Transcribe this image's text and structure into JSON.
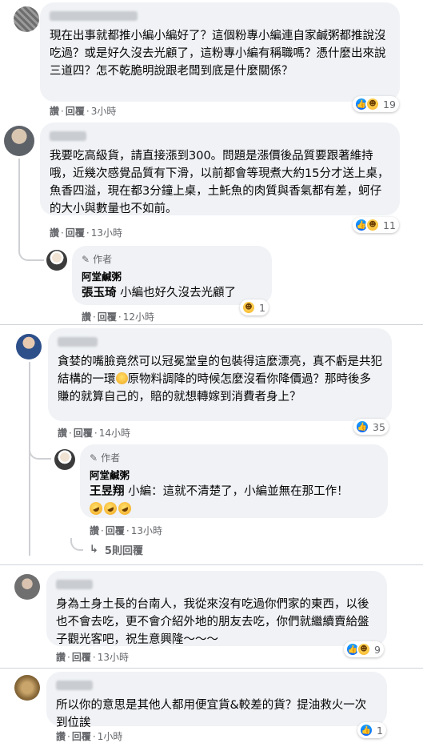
{
  "comments": [
    {
      "name": "",
      "text": "現在出事就都推小編小編好了？這個粉專小編連自家鹹粥都推說沒吃過？或是好久沒去光顧了，這粉專小編有稱職嗎？憑什麼出來說三道四？怎不乾脆明說跟老闆到底是什麼關係？",
      "like_label": "讚",
      "reply_label": "回覆",
      "time": "3小時",
      "reaction_count": "19"
    },
    {
      "name": "",
      "text": "我要吃高級貨，請直接漲到300。問題是漲價後品質要跟著維持哦，近幾次感覺品質有下滑，以前都會等現煮大約15分才送上桌，魚香四溢，現在都3分鐘上桌，土魠魚的肉質與香氣都有差，蚵仔的大小與數量也不如前。",
      "like_label": "讚",
      "reply_label": "回覆",
      "time": "13小時",
      "reaction_count": "11",
      "reply": {
        "author_tag": "作者",
        "page_name": "阿堂鹹粥",
        "mention": "張玉琦",
        "text": " 小編也好久沒去光顧了",
        "like_label": "讚",
        "reply_label": "回覆",
        "time": "12小時",
        "reaction_count": "1"
      }
    },
    {
      "name": "",
      "text_before_emoji": "貪婪的嘴臉竟然可以冠冕堂皇的包裝得這麼漂亮，真不虧是共犯結構的一環",
      "text_after_emoji": "原物料調降的時候怎麼沒看你降價過？那時後多賺的就算自己的，賠的就想轉嫁到消費者身上？",
      "like_label": "讚",
      "reply_label": "回覆",
      "time": "14小時",
      "reaction_count": "35",
      "reply": {
        "author_tag": "作者",
        "page_name": "阿堂鹹粥",
        "mention": "王昱翔",
        "text": " 小編：這就不清楚了，小編並無在那工作！",
        "like_label": "讚",
        "reply_label": "回覆",
        "time": "13小時"
      },
      "more_replies": "5則回覆"
    },
    {
      "name": "",
      "text": "身為土身土長的台南人，我從來沒有吃過你們家的東西，以後也不會去吃，更不會介紹外地的朋友去吃，你們就繼續賣給盤子觀光客吧，祝生意興隆～～～",
      "like_label": "讚",
      "reply_label": "回覆",
      "time": "13小時",
      "reaction_count": "9"
    },
    {
      "name": "",
      "text": "所以你的意思是其他人都用便宜貨&較差的貨？提油救火一次到位誒",
      "like_label": "讚",
      "reply_label": "回覆",
      "time": "1小時",
      "reaction_count": "1"
    }
  ],
  "icons": {
    "like": "like-reaction-icon",
    "haha": "haha-reaction-icon",
    "author": "pencil-icon",
    "reply_arrow": "reply-arrow-icon"
  },
  "colors": {
    "bubble": "#f0f2f5",
    "meta": "#65676b",
    "like": "#0866ff",
    "haha": "#f7b125"
  }
}
